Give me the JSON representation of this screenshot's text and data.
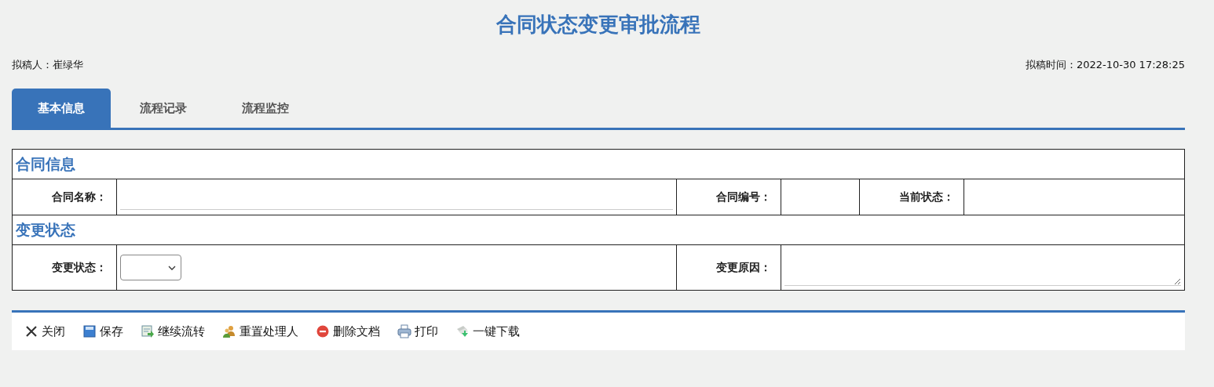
{
  "title": "合同状态变更审批流程",
  "drafter": {
    "label": "拟稿人：",
    "value": "崔绿华"
  },
  "draft_time": {
    "label": "拟稿时间：",
    "value": "2022-10-30 17:28:25"
  },
  "tabs": [
    {
      "label": "基本信息",
      "selected": true
    },
    {
      "label": "流程记录",
      "selected": false
    },
    {
      "label": "流程监控",
      "selected": false
    }
  ],
  "contract_section": {
    "heading": "合同信息",
    "fields": [
      {
        "label": "合同名称：",
        "kind": "input"
      },
      {
        "label": "合同编号：",
        "kind": "text"
      },
      {
        "label": "当前状态：",
        "kind": "text"
      }
    ]
  },
  "change_section": {
    "heading": "变更状态",
    "fields": [
      {
        "label": "变更状态：",
        "kind": "select"
      },
      {
        "label": "变更原因：",
        "kind": "textarea"
      }
    ]
  },
  "toolbar": [
    {
      "label": "关闭",
      "kind": "close"
    },
    {
      "label": "保存",
      "kind": "save"
    },
    {
      "label": "继续流转",
      "kind": "forward"
    },
    {
      "label": "重置处理人",
      "kind": "users"
    },
    {
      "label": "删除文档",
      "kind": "delete"
    },
    {
      "label": "打印",
      "kind": "print"
    },
    {
      "label": "一键下载",
      "kind": "download"
    }
  ]
}
